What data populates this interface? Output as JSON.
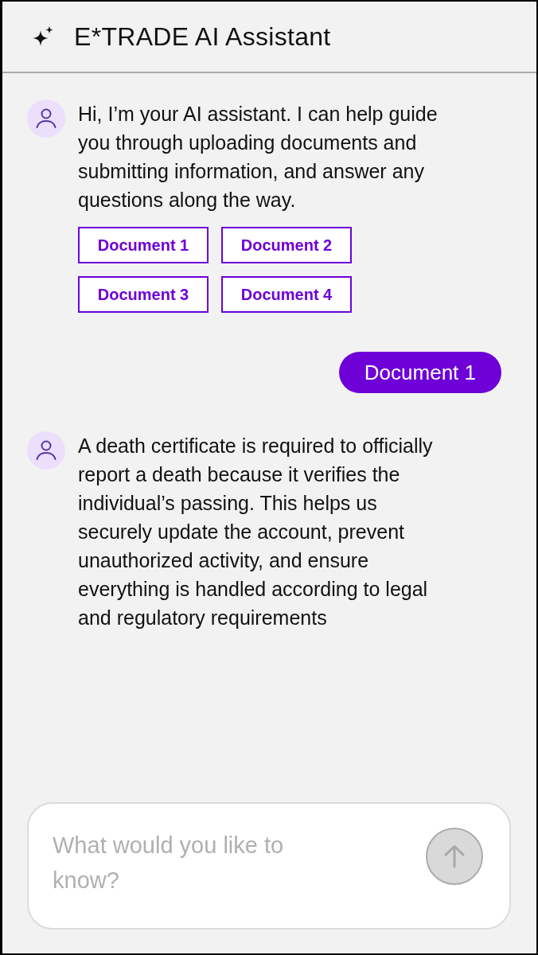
{
  "header": {
    "title": "E*TRADE AI Assistant"
  },
  "messages": [
    {
      "kind": "assistant",
      "text": "Hi, I’m your AI assistant. I can help guide you through uploading documents and submitting information, and answer any questions along the way.",
      "options": [
        {
          "label": "Document 1"
        },
        {
          "label": "Document 2"
        },
        {
          "label": "Document 3"
        },
        {
          "label": "Document 4"
        }
      ]
    },
    {
      "kind": "user",
      "text": "Document 1"
    },
    {
      "kind": "assistant",
      "text": "A death certificate is required to officially report a death because it verifies the individual’s passing. This helps us securely update the account, prevent unauthorized activity, and ensure everything is handled according to legal and regulatory requirements"
    }
  ],
  "composer": {
    "placeholder": "What would you like to know?",
    "send_button": {
      "disabled": true
    }
  }
}
